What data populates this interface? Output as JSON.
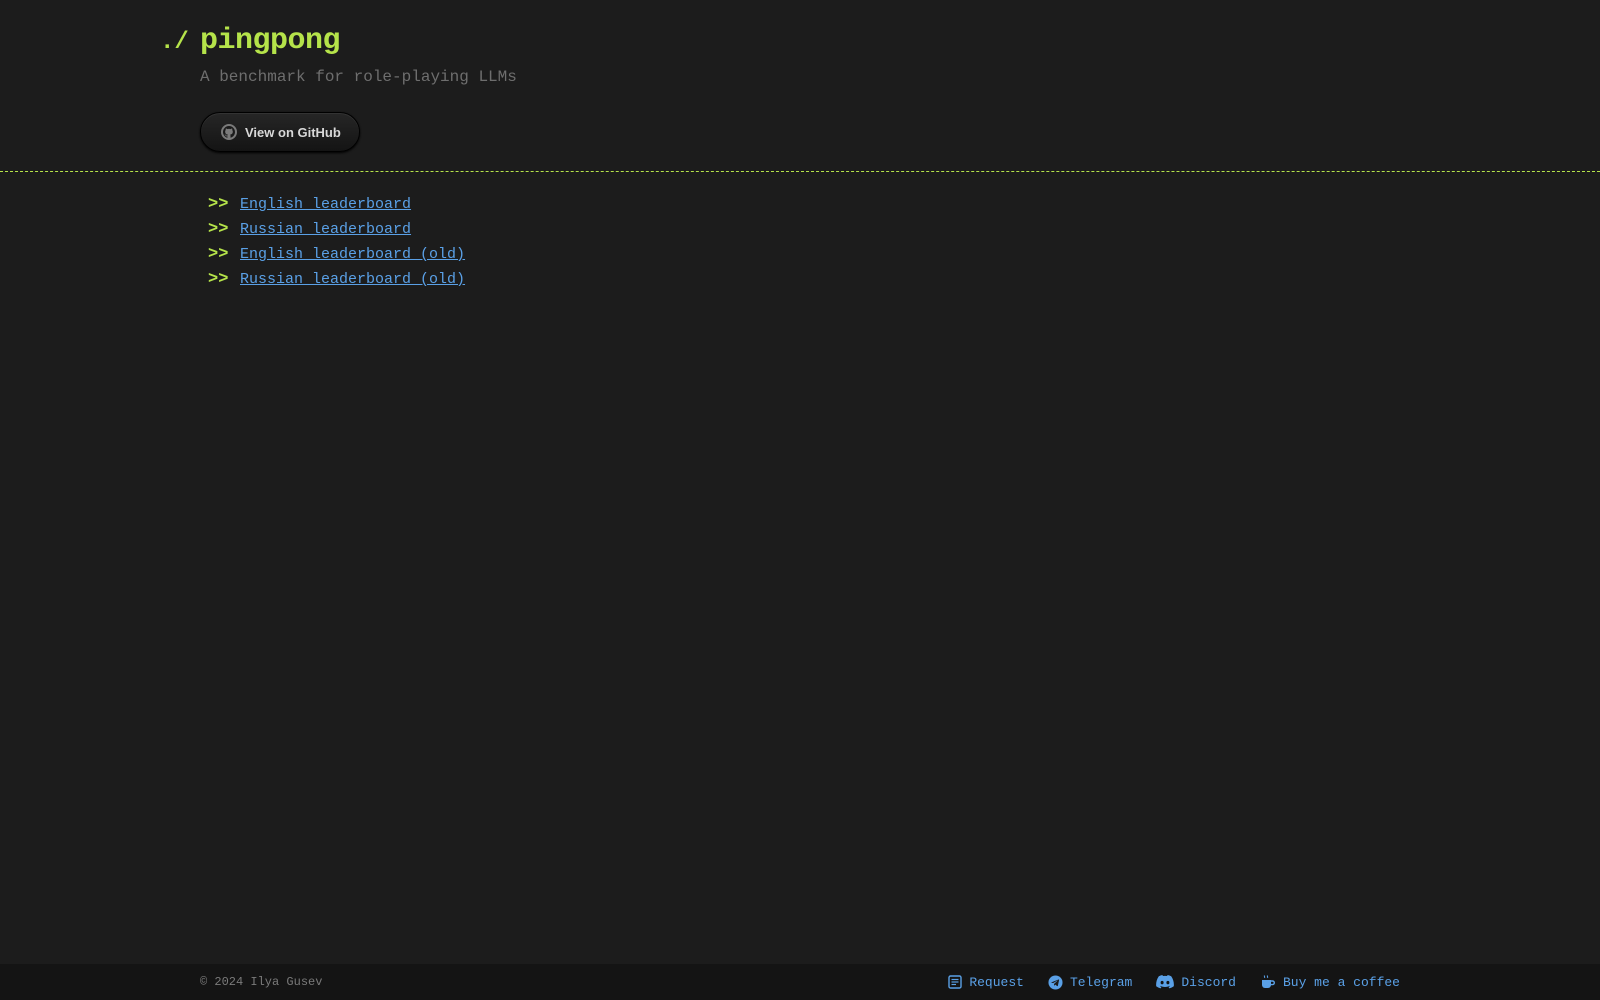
{
  "header": {
    "prompt": "./",
    "title": "pingpong",
    "subtitle": "A benchmark for role-playing LLMs",
    "github_button": {
      "label": "View on GitHub",
      "icon": "github-icon"
    }
  },
  "nav": {
    "marker": ">>",
    "links": [
      {
        "label": "English leaderboard"
      },
      {
        "label": "Russian leaderboard"
      },
      {
        "label": "English leaderboard (old)"
      },
      {
        "label": "Russian leaderboard (old)"
      }
    ]
  },
  "footer": {
    "copyright": "© 2024 Ilya Gusev",
    "links": [
      {
        "label": "Request",
        "icon": "request-form-icon"
      },
      {
        "label": "Telegram",
        "icon": "telegram-icon"
      },
      {
        "label": "Discord",
        "icon": "discord-icon"
      },
      {
        "label": "Buy me a coffee",
        "icon": "coffee-cup-icon"
      }
    ]
  },
  "colors": {
    "background": "#1c1c1c",
    "accent_green": "#b5e34a",
    "link_blue": "#5aa0e6",
    "footer_background": "#141414"
  }
}
